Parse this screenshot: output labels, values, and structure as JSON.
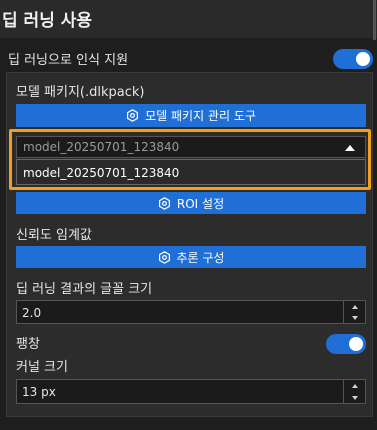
{
  "header": {
    "title": "딥 러닝 사용"
  },
  "deep_learning_recognition": {
    "label": "딥 러닝으로 인식 지원",
    "enabled": true
  },
  "model_package": {
    "label": "모델 패키지(.dlkpack)",
    "manage_button_label": "모델 패키지 관리 도구",
    "selected_value": "model_20250701_123840",
    "options": [
      "model_20250701_123840"
    ]
  },
  "roi_button_label": "ROI 설정",
  "confidence": {
    "label": "신뢰도 임계값"
  },
  "inference_button_label": "추론 구성",
  "font_size": {
    "label": "딥 러닝 결과의 글꼴 크기",
    "value": "2.0"
  },
  "dilation": {
    "label": "팽창",
    "enabled": true
  },
  "kernel_size": {
    "label": "커널 크기",
    "value": "13 px"
  },
  "colors": {
    "accent": "#1f6fd6",
    "highlight": "#f0a01e",
    "background": "#1e1e1e",
    "panel": "#2c2c2c"
  }
}
